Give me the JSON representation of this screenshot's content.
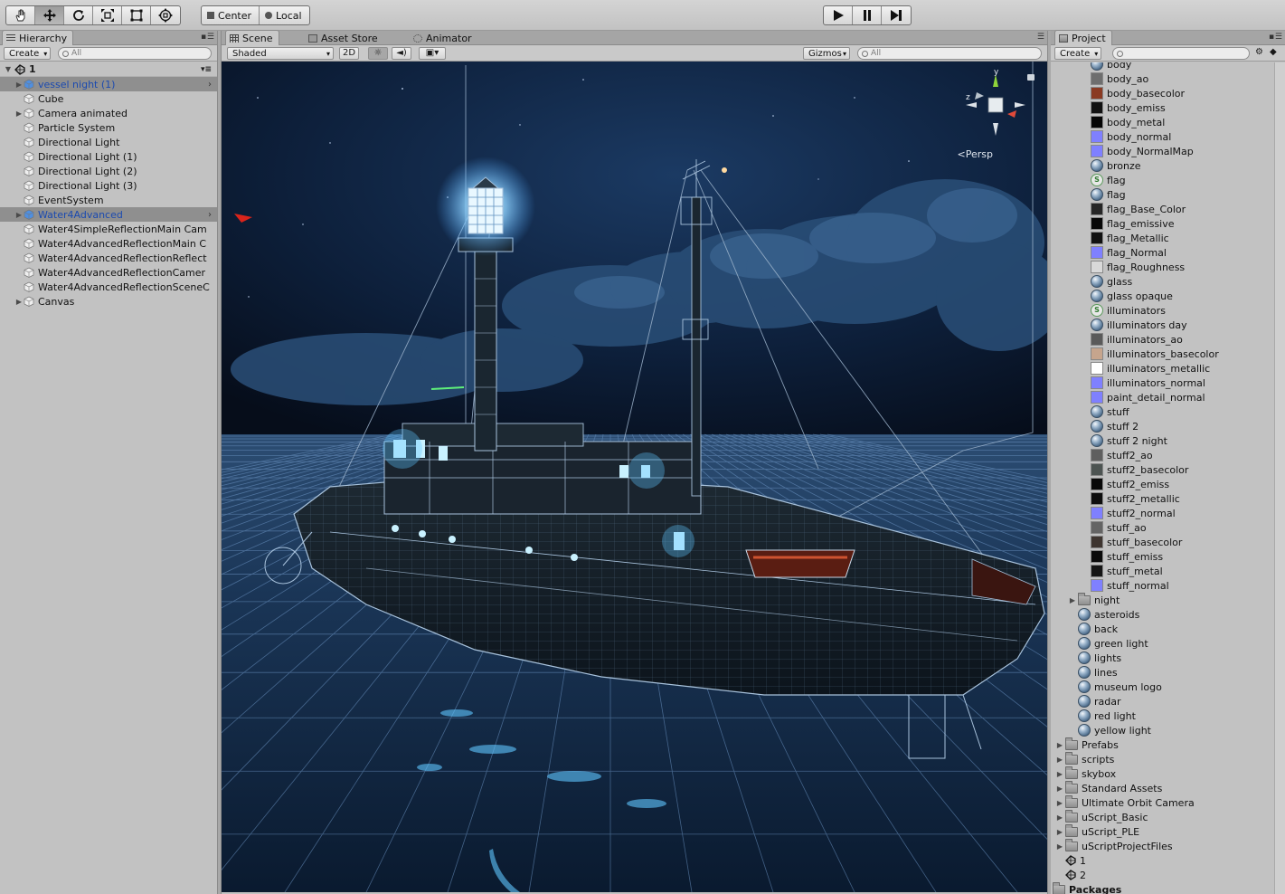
{
  "toolbar": {
    "tools": [
      "hand-tool",
      "move-tool",
      "rotate-tool",
      "scale-tool",
      "rect-tool",
      "transform-tool"
    ],
    "active_tool": "move-tool",
    "pivot_label": "Center",
    "space_label": "Local"
  },
  "hierarchy": {
    "tab_label": "Hierarchy",
    "create_label": "Create",
    "search_placeholder": "All",
    "scene_name": "1",
    "items": [
      {
        "label": "vessel night (1)",
        "expand": "▶",
        "state": "selected"
      },
      {
        "label": "Cube",
        "expand": "",
        "state": ""
      },
      {
        "label": "Camera animated",
        "expand": "▶",
        "state": ""
      },
      {
        "label": "Particle System",
        "expand": "",
        "state": ""
      },
      {
        "label": "Directional Light",
        "expand": "",
        "state": ""
      },
      {
        "label": "Directional Light (1)",
        "expand": "",
        "state": ""
      },
      {
        "label": "Directional Light (2)",
        "expand": "",
        "state": ""
      },
      {
        "label": "Directional Light (3)",
        "expand": "",
        "state": ""
      },
      {
        "label": "EventSystem",
        "expand": "",
        "state": ""
      },
      {
        "label": "Water4Advanced",
        "expand": "▶",
        "state": "selected"
      },
      {
        "label": "Water4SimpleReflectionMain Cam",
        "expand": "",
        "state": ""
      },
      {
        "label": "Water4AdvancedReflectionMain C",
        "expand": "",
        "state": ""
      },
      {
        "label": "Water4AdvancedReflectionReflect",
        "expand": "",
        "state": ""
      },
      {
        "label": "Water4AdvancedReflectionCamer",
        "expand": "",
        "state": ""
      },
      {
        "label": "Water4AdvancedReflectionSceneC",
        "expand": "",
        "state": ""
      },
      {
        "label": "Canvas",
        "expand": "▶",
        "state": ""
      }
    ]
  },
  "scene": {
    "tabs": [
      "Scene",
      "Asset Store",
      "Animator"
    ],
    "active_tab": "Scene",
    "draw_mode": "Shaded",
    "mode_2d": "2D",
    "gizmos_label": "Gizmos",
    "search_placeholder": "All",
    "persp_label": "Persp",
    "gizmo_axes": {
      "y": "y",
      "z": "z"
    }
  },
  "project": {
    "tab_label": "Project",
    "create_label": "Create",
    "items": [
      {
        "label": "body",
        "icon": "material",
        "indent": 2,
        "expand": "",
        "color": ""
      },
      {
        "label": "body_ao",
        "icon": "texture",
        "indent": 2,
        "expand": "",
        "color": "#6e6e6e"
      },
      {
        "label": "body_basecolor",
        "icon": "texture",
        "indent": 2,
        "expand": "",
        "color": "#8a3a22"
      },
      {
        "label": "body_emiss",
        "icon": "texture",
        "indent": 2,
        "expand": "",
        "color": "#111111"
      },
      {
        "label": "body_metal",
        "icon": "texture",
        "indent": 2,
        "expand": "",
        "color": "#050505"
      },
      {
        "label": "body_normal",
        "icon": "texture",
        "indent": 2,
        "expand": "",
        "color": "#7f80ff"
      },
      {
        "label": "body_NormalMap",
        "icon": "texture",
        "indent": 2,
        "expand": "",
        "color": "#7f80ff"
      },
      {
        "label": "bronze",
        "icon": "material",
        "indent": 2,
        "expand": "",
        "color": ""
      },
      {
        "label": "flag",
        "icon": "script",
        "indent": 2,
        "expand": "",
        "color": ""
      },
      {
        "label": "flag",
        "icon": "material",
        "indent": 2,
        "expand": "",
        "color": ""
      },
      {
        "label": "flag_Base_Color",
        "icon": "texture",
        "indent": 2,
        "expand": "",
        "color": "#262626"
      },
      {
        "label": "flag_emissive",
        "icon": "texture",
        "indent": 2,
        "expand": "",
        "color": "#070707"
      },
      {
        "label": "flag_Metallic",
        "icon": "texture",
        "indent": 2,
        "expand": "",
        "color": "#111111"
      },
      {
        "label": "flag_Normal",
        "icon": "texture",
        "indent": 2,
        "expand": "",
        "color": "#7f80ff"
      },
      {
        "label": "flag_Roughness",
        "icon": "texture",
        "indent": 2,
        "expand": "",
        "color": "#d9d9d9"
      },
      {
        "label": "glass",
        "icon": "material",
        "indent": 2,
        "expand": "",
        "color": ""
      },
      {
        "label": "glass opaque",
        "icon": "material",
        "indent": 2,
        "expand": "",
        "color": ""
      },
      {
        "label": "illuminators",
        "icon": "script",
        "indent": 2,
        "expand": "",
        "color": ""
      },
      {
        "label": "illuminators day",
        "icon": "material",
        "indent": 2,
        "expand": "",
        "color": ""
      },
      {
        "label": "illuminators_ao",
        "icon": "texture",
        "indent": 2,
        "expand": "",
        "color": "#5a5a5a"
      },
      {
        "label": "illuminators_basecolor",
        "icon": "texture",
        "indent": 2,
        "expand": "",
        "color": "#c6a58d"
      },
      {
        "label": "illuminators_metallic",
        "icon": "texture",
        "indent": 2,
        "expand": "",
        "color": "#ffffff"
      },
      {
        "label": "illuminators_normal",
        "icon": "texture",
        "indent": 2,
        "expand": "",
        "color": "#7f80ff"
      },
      {
        "label": "paint_detail_normal",
        "icon": "texture",
        "indent": 2,
        "expand": "",
        "color": "#7f80ff"
      },
      {
        "label": "stuff",
        "icon": "material",
        "indent": 2,
        "expand": "",
        "color": ""
      },
      {
        "label": "stuff 2",
        "icon": "material",
        "indent": 2,
        "expand": "",
        "color": ""
      },
      {
        "label": "stuff 2 night",
        "icon": "material",
        "indent": 2,
        "expand": "",
        "color": ""
      },
      {
        "label": "stuff2_ao",
        "icon": "texture",
        "indent": 2,
        "expand": "",
        "color": "#5f5f5f"
      },
      {
        "label": "stuff2_basecolor",
        "icon": "texture",
        "indent": 2,
        "expand": "",
        "color": "#4d5452"
      },
      {
        "label": "stuff2_emiss",
        "icon": "texture",
        "indent": 2,
        "expand": "",
        "color": "#090909"
      },
      {
        "label": "stuff2_metallic",
        "icon": "texture",
        "indent": 2,
        "expand": "",
        "color": "#0e0e0e"
      },
      {
        "label": "stuff2_normal",
        "icon": "texture",
        "indent": 2,
        "expand": "",
        "color": "#7f80ff"
      },
      {
        "label": "stuff_ao",
        "icon": "texture",
        "indent": 2,
        "expand": "",
        "color": "#646464"
      },
      {
        "label": "stuff_basecolor",
        "icon": "texture",
        "indent": 2,
        "expand": "",
        "color": "#3e3530"
      },
      {
        "label": "stuff_emiss",
        "icon": "texture",
        "indent": 2,
        "expand": "",
        "color": "#0b0b0b"
      },
      {
        "label": "stuff_metal",
        "icon": "texture",
        "indent": 2,
        "expand": "",
        "color": "#151515"
      },
      {
        "label": "stuff_normal",
        "icon": "texture",
        "indent": 2,
        "expand": "",
        "color": "#7f80ff"
      },
      {
        "label": "night",
        "icon": "folder",
        "indent": 1,
        "expand": "▶",
        "color": ""
      },
      {
        "label": "asteroids",
        "icon": "material",
        "indent": 1,
        "expand": "",
        "color": ""
      },
      {
        "label": "back",
        "icon": "material",
        "indent": 1,
        "expand": "",
        "color": ""
      },
      {
        "label": "green light",
        "icon": "material",
        "indent": 1,
        "expand": "",
        "color": ""
      },
      {
        "label": "lights",
        "icon": "material",
        "indent": 1,
        "expand": "",
        "color": ""
      },
      {
        "label": "lines",
        "icon": "material",
        "indent": 1,
        "expand": "",
        "color": ""
      },
      {
        "label": "museum logo",
        "icon": "material",
        "indent": 1,
        "expand": "",
        "color": ""
      },
      {
        "label": "radar",
        "icon": "material",
        "indent": 1,
        "expand": "",
        "color": ""
      },
      {
        "label": "red light",
        "icon": "material",
        "indent": 1,
        "expand": "",
        "color": ""
      },
      {
        "label": "yellow light",
        "icon": "material",
        "indent": 1,
        "expand": "",
        "color": ""
      },
      {
        "label": "Prefabs",
        "icon": "folder",
        "indent": 0,
        "expand": "▶",
        "color": ""
      },
      {
        "label": "scripts",
        "icon": "folder",
        "indent": 0,
        "expand": "▶",
        "color": ""
      },
      {
        "label": "skybox",
        "icon": "folder",
        "indent": 0,
        "expand": "▶",
        "color": ""
      },
      {
        "label": "Standard Assets",
        "icon": "folder",
        "indent": 0,
        "expand": "▶",
        "color": ""
      },
      {
        "label": "Ultimate Orbit Camera",
        "icon": "folder",
        "indent": 0,
        "expand": "▶",
        "color": ""
      },
      {
        "label": "uScript_Basic",
        "icon": "folder",
        "indent": 0,
        "expand": "▶",
        "color": ""
      },
      {
        "label": "uScript_PLE",
        "icon": "folder",
        "indent": 0,
        "expand": "▶",
        "color": ""
      },
      {
        "label": "uScriptProjectFiles",
        "icon": "folder",
        "indent": 0,
        "expand": "▶",
        "color": ""
      },
      {
        "label": "1",
        "icon": "unity",
        "indent": 0,
        "expand": "",
        "color": ""
      },
      {
        "label": "2",
        "icon": "unity",
        "indent": 0,
        "expand": "",
        "color": ""
      },
      {
        "label": "Packages",
        "icon": "folder",
        "indent": -1,
        "expand": "▶",
        "color": ""
      }
    ]
  },
  "colors": {
    "selection": "#8f8f8f",
    "prefab_text": "#1b4ab0",
    "scene_sky": "#0b1526",
    "wire": "#6f98c8"
  }
}
